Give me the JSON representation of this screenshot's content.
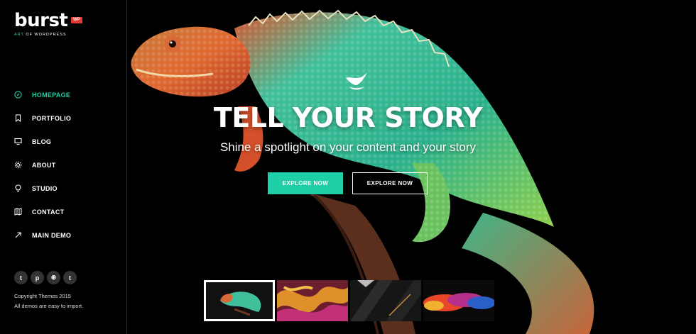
{
  "brand": {
    "name": "burst",
    "badge": "WP",
    "tagline_accent": "ART",
    "tagline_rest": " OF WORDPRESS"
  },
  "nav": [
    {
      "label": "HOMEPAGE",
      "icon": "compass-icon",
      "active": true
    },
    {
      "label": "PORTFOLIO",
      "icon": "bookmark-icon",
      "active": false
    },
    {
      "label": "BLOG",
      "icon": "monitor-icon",
      "active": false
    },
    {
      "label": "ABOUT",
      "icon": "gear-icon",
      "active": false
    },
    {
      "label": "STUDIO",
      "icon": "lightbulb-icon",
      "active": false
    },
    {
      "label": "CONTACT",
      "icon": "map-icon",
      "active": false
    },
    {
      "label": "MAIN DEMO",
      "icon": "arrow-icon",
      "active": false
    }
  ],
  "social": [
    {
      "glyph": "t",
      "icon": "twitter-icon"
    },
    {
      "glyph": "p",
      "icon": "pinterest-icon"
    },
    {
      "glyph": "⊛",
      "icon": "dribbble-icon"
    },
    {
      "glyph": "t",
      "icon": "tumblr-icon"
    }
  ],
  "footer": {
    "line1": "Copyright Themes 2015",
    "line2": "All demos are easy to import."
  },
  "hero": {
    "title": "TELL YOUR STORY",
    "subtitle": "Shine a spotlight on your content and your story",
    "primary_button": "EXPLORE NOW",
    "secondary_button": "EXPLORE NOW"
  },
  "colors": {
    "accent": "#1fcfa8",
    "badge": "#e53935",
    "background": "#000000"
  },
  "thumbnails": [
    {
      "name": "chameleon-thumbnail",
      "active": true
    },
    {
      "name": "swirl-thumbnail",
      "active": false
    },
    {
      "name": "dark-geometric-thumbnail",
      "active": false
    },
    {
      "name": "color-smoke-thumbnail",
      "active": false
    }
  ]
}
